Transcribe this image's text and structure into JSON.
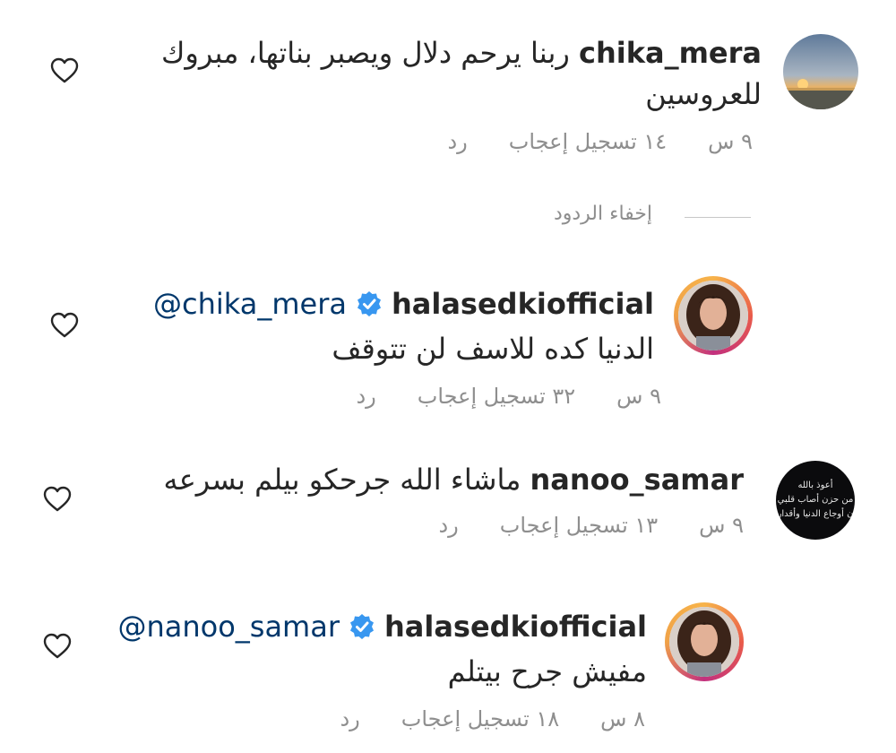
{
  "comments": [
    {
      "username": "chika_mera",
      "text_line1": "ربنا يرحم دلال ويصبر بناتها، مبروك",
      "text_line2": "للعروسين",
      "time": "٩ س",
      "likes": "١٤ تسجيل إعجاب",
      "reply": "رد"
    },
    {
      "username": "halasedkiofficial",
      "mention": "@chika_mera",
      "text": "الدنيا كده للاسف لن تتوقف",
      "time": "٩ س",
      "likes": "٣٢ تسجيل إعجاب",
      "reply": "رد"
    },
    {
      "username": "nanoo_samar",
      "text": "ماشاء الله جرحكو بيلم بسرعه",
      "time": "٩ س",
      "likes": "١٣ تسجيل إعجاب",
      "reply": "رد",
      "avatar_text": [
        "أعوذ بالله",
        "من حزن أصاب قلبي",
        "ن أوجاع الدنيا وأقدار"
      ]
    },
    {
      "username": "halasedkiofficial",
      "mention": "@nanoo_samar",
      "text": "مفيش جرح بيتلم",
      "time": "٨ س",
      "likes": "١٨ تسجيل إعجاب",
      "reply": "رد"
    }
  ],
  "hide_replies": "إخفاء الردود",
  "colors": {
    "text": "#262626",
    "meta": "#8e8e8e",
    "mention": "#00376b",
    "verified": "#3897f0"
  },
  "icons": {
    "like": "heart-outline-icon",
    "verified": "verified-badge-icon"
  }
}
